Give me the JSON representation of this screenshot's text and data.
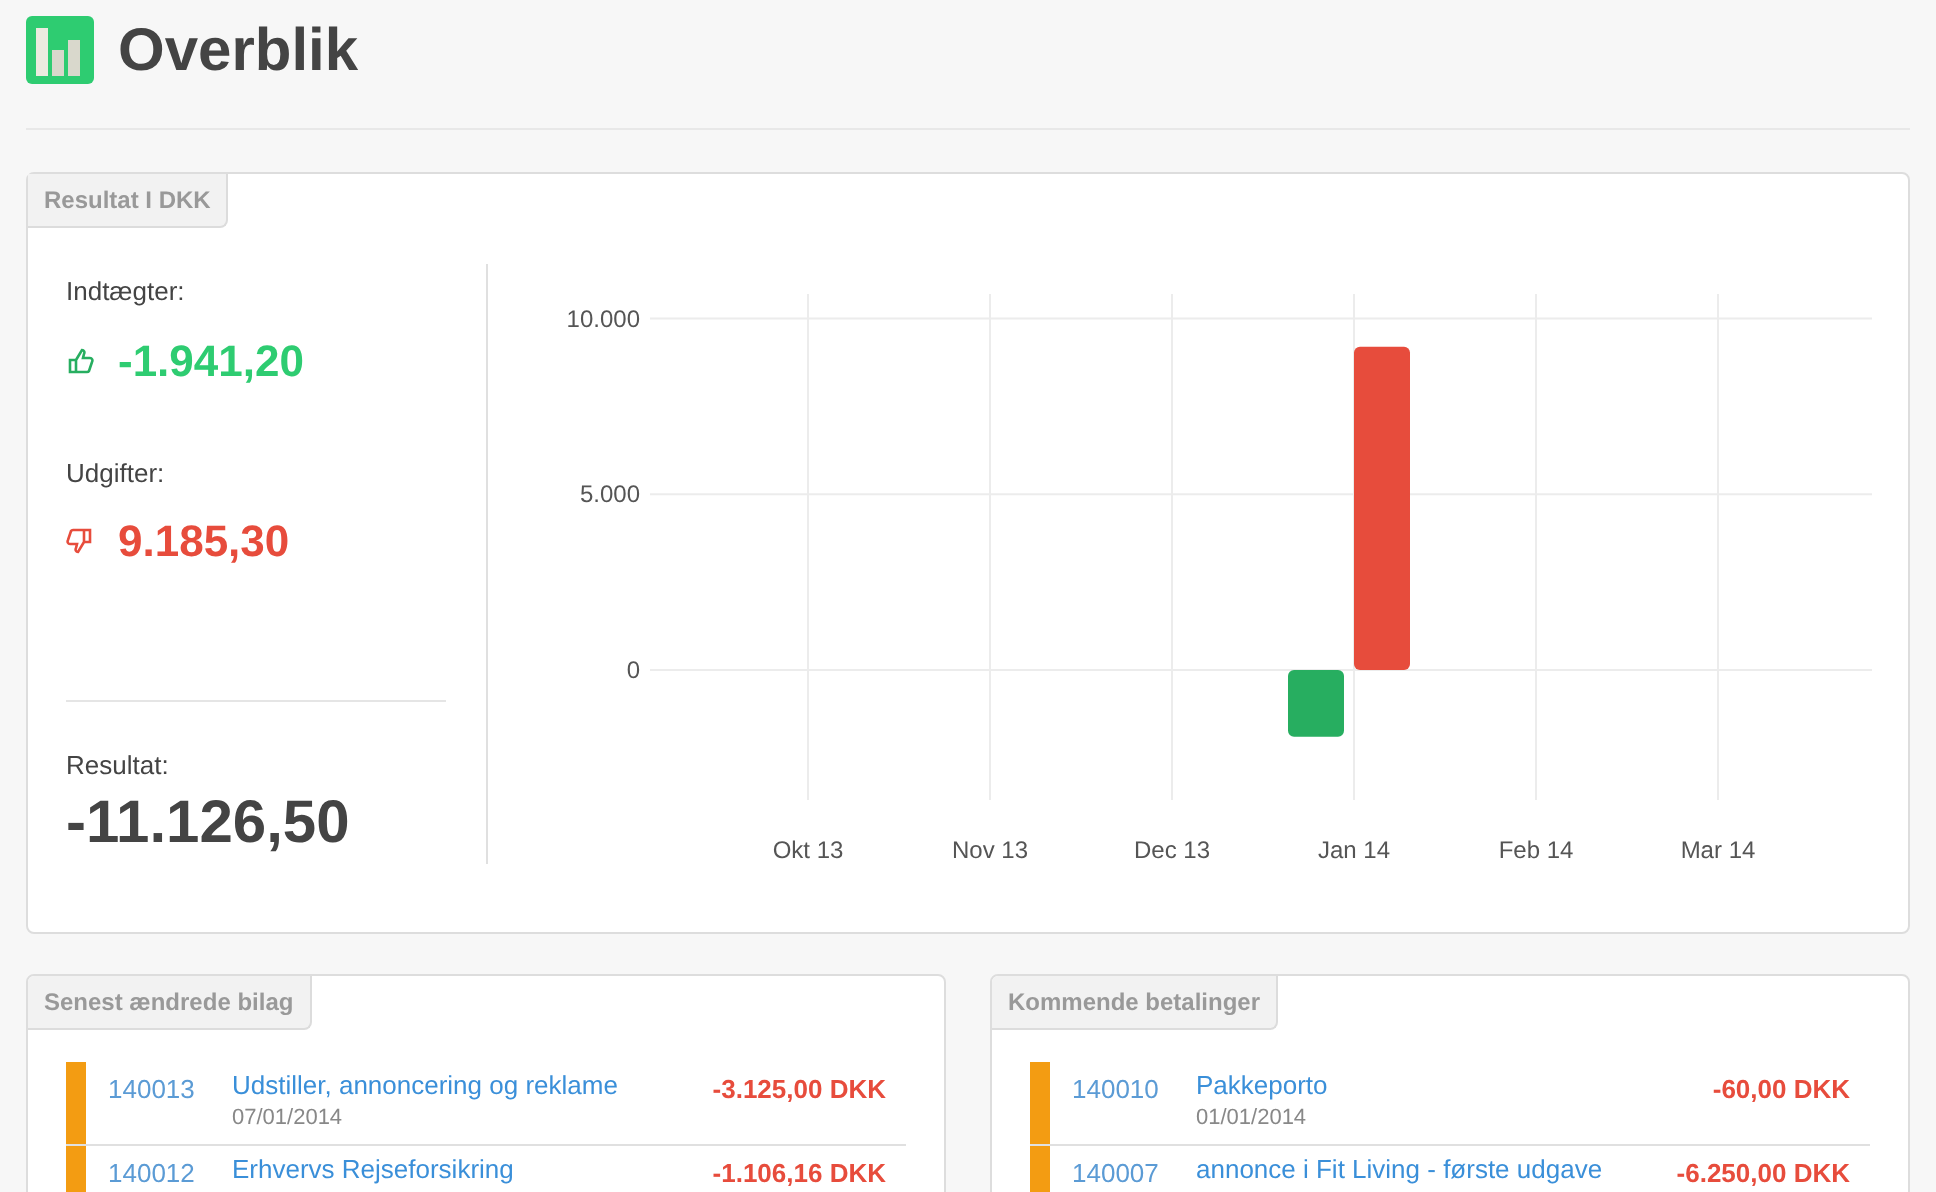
{
  "page": {
    "title": "Overblik"
  },
  "result_card": {
    "tab": "Resultat I DKK",
    "income": {
      "label": "Indtægter:",
      "value": "-1.941,20"
    },
    "expenses": {
      "label": "Udgifter:",
      "value": "9.185,30"
    },
    "result": {
      "label": "Resultat:",
      "value": "-11.126,50"
    },
    "chart_data": {
      "type": "bar",
      "categories": [
        "Okt 13",
        "Nov 13",
        "Dec 13",
        "Jan 14",
        "Feb 14",
        "Mar 14"
      ],
      "grid": true,
      "series": [
        {
          "color": "#27ae60",
          "values": [
            null,
            null,
            null,
            -1900,
            null,
            null
          ]
        },
        {
          "color": "#e74c3c",
          "values": [
            null,
            null,
            null,
            9200,
            null,
            null
          ]
        }
      ],
      "ylim": [
        -3700,
        10700
      ],
      "yticks": [
        {
          "value": 0,
          "label": "0"
        },
        {
          "value": 5000,
          "label": "5.000"
        },
        {
          "value": 10000,
          "label": "10.000"
        }
      ]
    }
  },
  "lists": [
    {
      "tab": "Senest ændrede bilag",
      "rows": [
        {
          "number": "140013",
          "title": "Udstiller, annoncering og reklame",
          "date": "07/01/2014",
          "amount": "-3.125,00 DKK",
          "color": "#f39c12"
        },
        {
          "number": "140012",
          "title": "Erhvervs Rejseforsikring",
          "amount": "-1.106,16 DKK",
          "color": "#f39c12"
        }
      ]
    },
    {
      "tab": "Kommende betalinger",
      "rows": [
        {
          "number": "140010",
          "title": "Pakkeporto",
          "date": "01/01/2014",
          "amount": "-60,00 DKK",
          "color": "#f39c12"
        },
        {
          "number": "140007",
          "title": "annonce i Fit Living - første udgave",
          "amount": "-6.250,00 DKK",
          "color": "#f39c12"
        }
      ]
    }
  ]
}
